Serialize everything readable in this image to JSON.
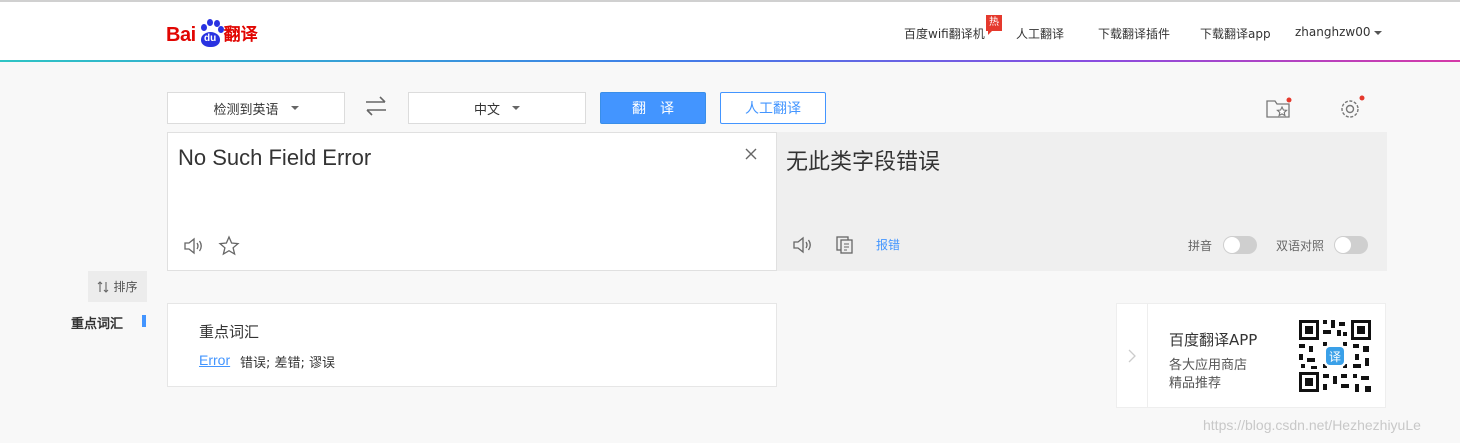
{
  "logo": {
    "left": "Bai",
    "paw": "du",
    "right": "翻译"
  },
  "nav": {
    "wifi": "百度wifi翻译机",
    "hot_badge": "热",
    "human": "人工翻译",
    "plugin": "下载翻译插件",
    "app": "下载翻译app",
    "user": "zhanghzw00"
  },
  "toolbar": {
    "source_lang": "检测到英语",
    "target_lang": "中文",
    "translate_label": "翻译",
    "human_label": "人工翻译"
  },
  "source": {
    "text": "No Such Field Error"
  },
  "output": {
    "text": "无此类字段错误",
    "report": "报错",
    "pinyin_label": "拼音",
    "pinyin_on": false,
    "bilingual_label": "双语对照",
    "bilingual_on": false
  },
  "sidebar": {
    "sort_label": "排序",
    "active_item": "重点词汇"
  },
  "vocab": {
    "title": "重点词汇",
    "items": [
      {
        "word": "Error",
        "definition": "错误; 差错; 谬误"
      }
    ]
  },
  "app_promo": {
    "title": "百度翻译APP",
    "line1": "各大应用商店",
    "line2": "精品推荐"
  },
  "watermark": "https://blog.csdn.net/HezhezhiyuLe",
  "colors": {
    "brand_red": "#e10602",
    "brand_blue": "#2932e1",
    "accent": "#4395ff",
    "hot": "#e5392d"
  }
}
